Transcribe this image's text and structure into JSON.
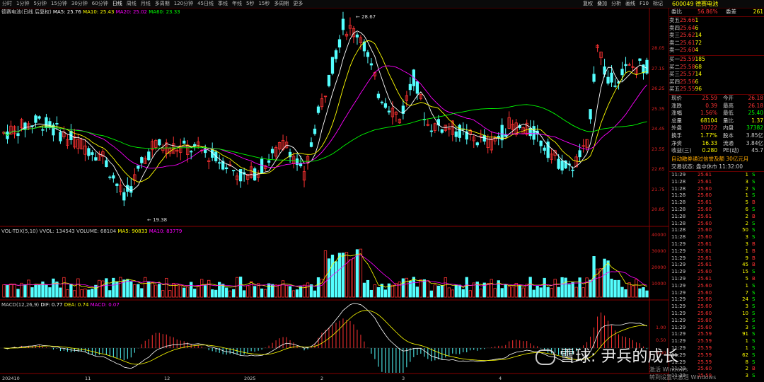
{
  "toolbar": {
    "periods": [
      "分时",
      "1分钟",
      "5分钟",
      "15分钟",
      "30分钟",
      "60分钟",
      "日线",
      "周线",
      "月线",
      "多周期",
      "120分钟",
      "45日线",
      "季线",
      "年线",
      "5秒",
      "15秒",
      "多周期",
      "更多"
    ],
    "active": "日线",
    "right_buttons": [
      "复权",
      "叠加",
      "分析",
      "画线",
      "F10",
      "标记"
    ],
    "stock_code": "600049",
    "stock_name": "德赛电池"
  },
  "main_legend": {
    "stock": "德赛电池(日线 后复权)",
    "ma5": "MA5: 25.76",
    "ma10": "MA10: 25.43",
    "ma20": "MA20: 25.02",
    "ma60": "MA60: 23.33"
  },
  "vol_legend": {
    "name": "VOL-TDX(5,10)",
    "vvol": "VVOL: 134543",
    "volume": "VOLUME: 68104",
    "ma5": "MA5: 90833",
    "ma10": "MA10: 83779"
  },
  "macd_legend": {
    "name": "MACD(12,26,9)",
    "dif": "DIF: 0.77",
    "dea": "DEA: 0.74",
    "macd": "MACD: 0.07"
  },
  "annotations": {
    "high": "28.67",
    "low": "19.38"
  },
  "price_axis": [
    "28.05",
    "27.15",
    "26.25",
    "25.35",
    "24.45",
    "23.55",
    "22.65",
    "21.75",
    "20.85"
  ],
  "vol_axis": [
    "40000",
    "30000",
    "20000",
    "10000"
  ],
  "macd_axis": [
    "1.00",
    "0.50",
    "0.00"
  ],
  "x_axis": [
    "202410",
    "11",
    "12",
    "2025",
    "2",
    "3",
    "4"
  ],
  "colors": {
    "up": "#ff3232",
    "down": "#54ffff",
    "ma5": "#ffffff",
    "ma10": "#ffff00",
    "ma20": "#ff00ff",
    "ma60": "#00ff00"
  },
  "panel": {
    "weibi_label": "委比",
    "weibi_value": "56.86%",
    "weicha_label": "委差",
    "weicha_value": "261",
    "sells": [
      {
        "label": "卖五",
        "price": "25.66",
        "vol": "1"
      },
      {
        "label": "卖四",
        "price": "25.64",
        "vol": "6"
      },
      {
        "label": "卖三",
        "price": "25.62",
        "vol": "14"
      },
      {
        "label": "卖二",
        "price": "25.61",
        "vol": "72"
      },
      {
        "label": "卖一",
        "price": "25.60",
        "vol": "4"
      }
    ],
    "buys": [
      {
        "label": "买一",
        "price": "25.59",
        "vol": "185"
      },
      {
        "label": "买二",
        "price": "25.58",
        "vol": "68"
      },
      {
        "label": "买三",
        "price": "25.57",
        "vol": "14"
      },
      {
        "label": "买四",
        "price": "25.56",
        "vol": "6"
      },
      {
        "label": "买五",
        "price": "25.55",
        "vol": "96"
      }
    ],
    "details": [
      [
        "现价",
        "25.59",
        "今开",
        "26.18"
      ],
      [
        "涨跌",
        "0.39",
        "最高",
        "26.18"
      ],
      [
        "涨幅",
        "1.56%",
        "最低",
        "25.40"
      ],
      [
        "总量",
        "68104",
        "量比",
        "1.37"
      ],
      [
        "外盘",
        "30722",
        "内盘",
        "37382"
      ],
      [
        "换手",
        "1.77%",
        "股本",
        "3.85亿"
      ],
      [
        "净资",
        "16.33",
        "流通",
        "3.84亿"
      ],
      [
        "收益(三)",
        "0.280",
        "PE(动)",
        "45.7"
      ]
    ],
    "notice": "自动融券通过信誉及额 30亿元月",
    "status": "交易状态: 盘中休市 11:32:00",
    "trades": [
      [
        "11:29",
        "25.61",
        "1",
        "S"
      ],
      [
        "11:28",
        "25.61",
        "3",
        "S"
      ],
      [
        "11:28",
        "25.60",
        "2",
        "S"
      ],
      [
        "11:28",
        "25.60",
        "1",
        "S"
      ],
      [
        "11:28",
        "25.61",
        "5",
        "B"
      ],
      [
        "11:28",
        "25.60",
        "6",
        "S"
      ],
      [
        "11:28",
        "25.61",
        "2",
        "B"
      ],
      [
        "11:28",
        "25.60",
        "2",
        "S"
      ],
      [
        "11:28",
        "25.60",
        "50",
        "S"
      ],
      [
        "11:28",
        "25.60",
        "3",
        "S"
      ],
      [
        "11:29",
        "25.61",
        "3",
        "B"
      ],
      [
        "11:29",
        "25.61",
        "1",
        "B"
      ],
      [
        "11:29",
        "25.61",
        "9",
        "B"
      ],
      [
        "11:29",
        "25.61",
        "45",
        "B"
      ],
      [
        "11:29",
        "25.60",
        "15",
        "S"
      ],
      [
        "11:29",
        "25.61",
        "5",
        "B"
      ],
      [
        "11:29",
        "25.60",
        "1",
        "S"
      ],
      [
        "11:29",
        "25.60",
        "7",
        "S"
      ],
      [
        "11:29",
        "25.60",
        "24",
        "S"
      ],
      [
        "11:29",
        "25.60",
        "3",
        "S"
      ],
      [
        "11:29",
        "25.60",
        "10",
        "S"
      ],
      [
        "11:29",
        "25.60",
        "2",
        "S"
      ],
      [
        "11:29",
        "25.60",
        "3",
        "S"
      ],
      [
        "11:29",
        "25.59",
        "91",
        "S"
      ],
      [
        "11:29",
        "25.59",
        "1",
        "S"
      ],
      [
        "11:29",
        "25.59",
        "1",
        "S"
      ],
      [
        "11:29",
        "25.59",
        "62",
        "S"
      ],
      [
        "11:29",
        "25.59",
        "8",
        "S"
      ],
      [
        "11:29",
        "25.60",
        "2",
        "B"
      ],
      [
        "11:29",
        "25.59",
        "3",
        "S"
      ]
    ]
  },
  "watermark": {
    "text": "雪球: 尹兵的成长",
    "win1": "激活 Windows",
    "win2": "转到设置以激活 Windows"
  }
}
